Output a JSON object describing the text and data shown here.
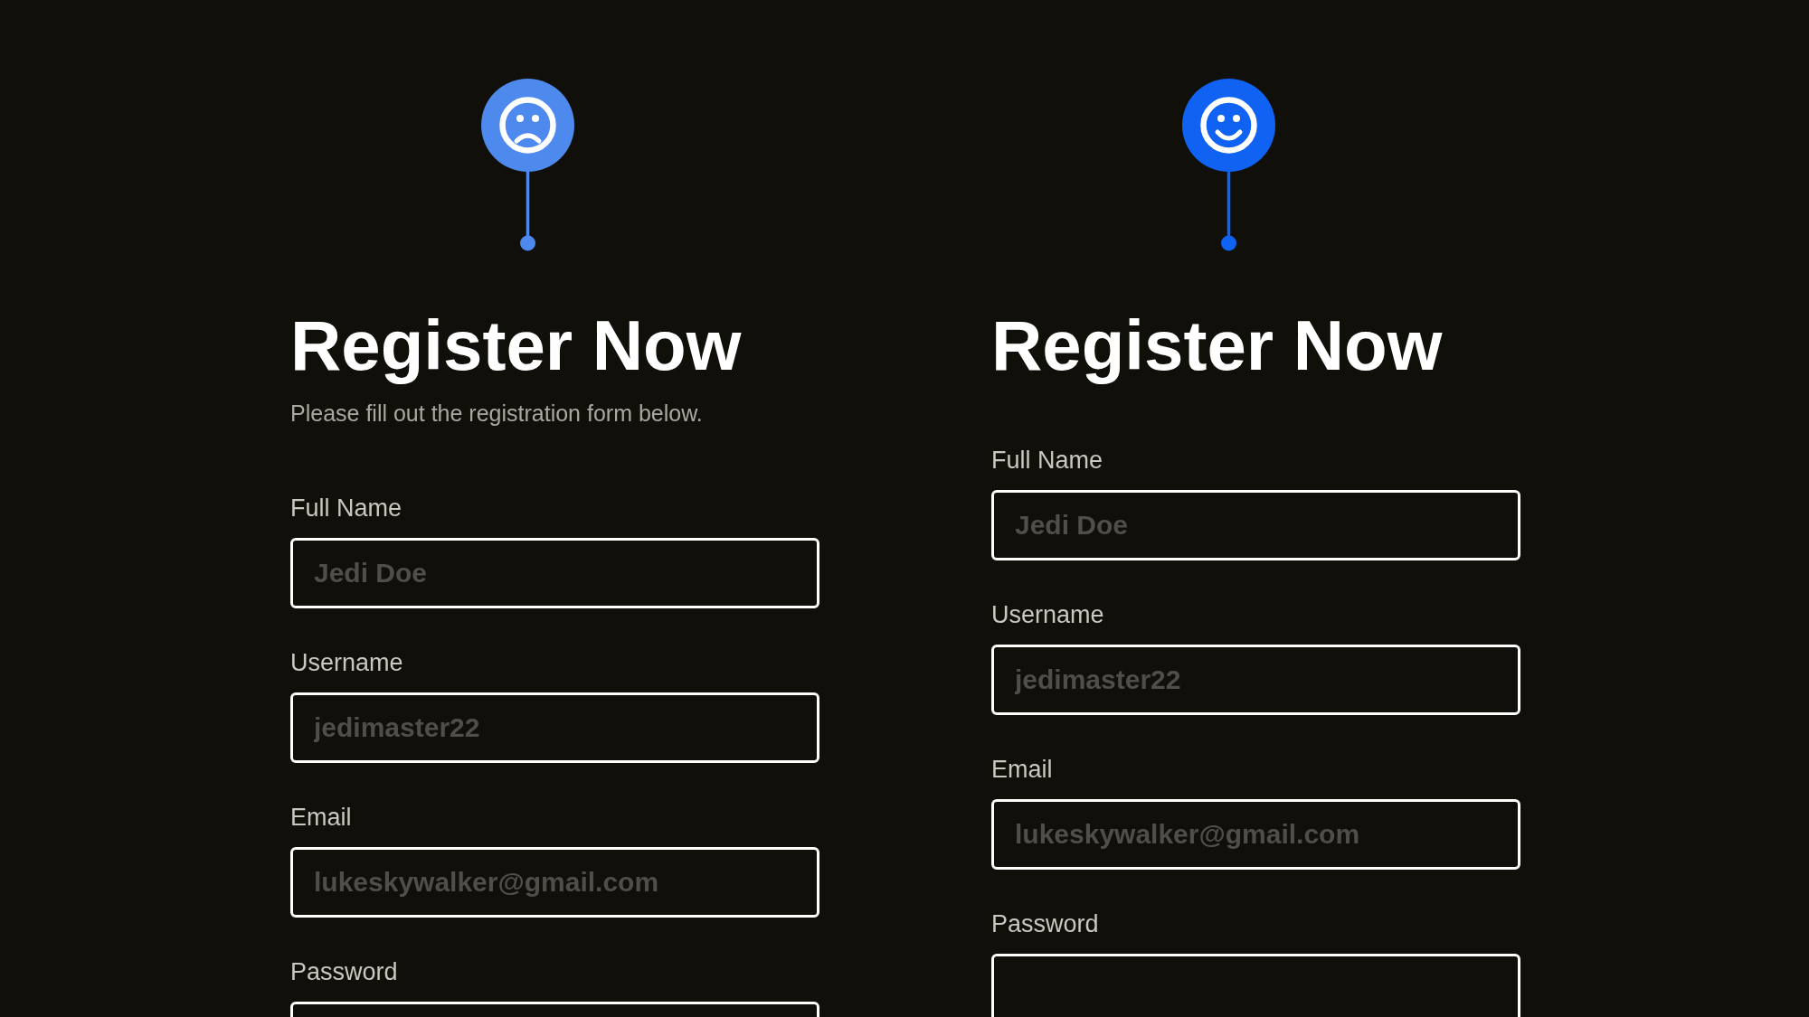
{
  "forms": [
    {
      "pin": {
        "kind": "sad",
        "color": "#4e89ee"
      },
      "title": "Register Now",
      "subtitle": "Please fill out the registration form below.",
      "fields": [
        {
          "label": "Full Name",
          "placeholder": "Jedi Doe"
        },
        {
          "label": "Username",
          "placeholder": "jedimaster22"
        },
        {
          "label": "Email",
          "placeholder": "lukeskywalker@gmail.com"
        },
        {
          "label": "Password"
        }
      ]
    },
    {
      "pin": {
        "kind": "happy",
        "color": "#1062f2"
      },
      "title": "Register Now",
      "fields": [
        {
          "label": "Full Name",
          "placeholder": "Jedi Doe"
        },
        {
          "label": "Username",
          "placeholder": "jedimaster22"
        },
        {
          "label": "Email",
          "placeholder": "lukeskywalker@gmail.com"
        },
        {
          "label": "Password"
        }
      ]
    }
  ]
}
